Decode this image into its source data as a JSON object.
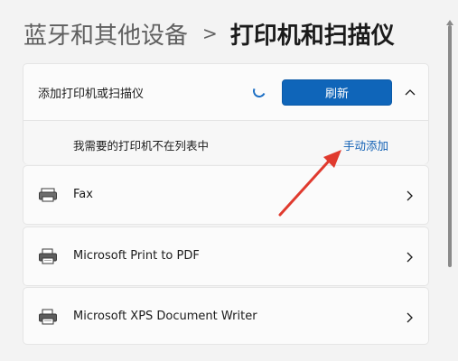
{
  "header": {
    "parent": "蓝牙和其他设备",
    "separator": ">",
    "current": "打印机和扫描仪"
  },
  "add_section": {
    "label": "添加打印机或扫描仪",
    "refresh_label": "刷新",
    "missing_text": "我需要的打印机不在列表中",
    "manual_add_label": "手动添加"
  },
  "printers": [
    {
      "name": "Fax",
      "icon": "fax-printer-icon"
    },
    {
      "name": "Microsoft Print to PDF",
      "icon": "printer-icon"
    },
    {
      "name": "Microsoft XPS Document Writer",
      "icon": "printer-icon"
    }
  ],
  "colors": {
    "accent": "#0f65b9",
    "link": "#0f5fb4",
    "annotation_arrow": "#e03a2e"
  }
}
